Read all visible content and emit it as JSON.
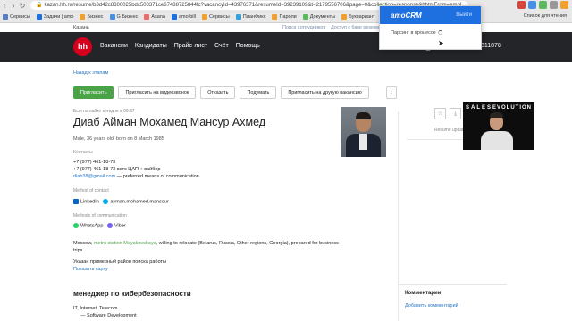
{
  "browser": {
    "url": "kazan.hh.ru/resume/b3d42c8300025bdc500371ce67488725844fc?vacancyId=43976371&resumeId=39239109&t=2179556706&page=0&collection=response&hhtmFrom=empl...",
    "bookmarks": [
      "Сервисы",
      "Задачи | amo",
      "Бизнес",
      "G Бизнес",
      "Asana",
      "amo bill",
      "Сервисы",
      "ПланФикс",
      "Пароли",
      "Документы",
      "Буквариант"
    ],
    "bookmarks_right": "Список для чтения",
    "colors": {
      "ext1": "#d6453b",
      "ext2": "#4a8fe7",
      "ext3": "#5cb85c",
      "ext4": "#999999",
      "ext5": "#f0a030"
    }
  },
  "hh": {
    "city": "Казань",
    "top_links": [
      "Поиск сотрудников",
      "Доступ к базе резюме"
    ],
    "logo": "hh",
    "menu": [
      "Вакансии",
      "Кандидаты",
      "Прайс-лист",
      "Счёт",
      "Помощь"
    ],
    "search_label": "Поиск",
    "phone": "811878"
  },
  "resume": {
    "back_link": "Назад к этапам",
    "actions": [
      "Пригласить",
      "Пригласить на видеозвонок",
      "Отказать",
      "Подумать",
      "Пригласить на другую вакансию"
    ],
    "more_label": "⋮",
    "last_seen": "Был на сайте сегодня в 09:37",
    "name": "Диаб Айман Мохамед Мансур Ахмед",
    "meta": "Male, 36 years old, born on 8 March 1985",
    "contacts_label": "Контакты",
    "phone1": "+7 (977) 461-18-73",
    "phone2": "+7 (977) 461-18-73 ватс ЦАП + вайбер",
    "email": "diab38@gmail.com",
    "email_note": " — preferred means of communication",
    "method_label": "Method of contact",
    "linkedin": "LinkedIn",
    "skype": "ayman.mohamed.mansour",
    "comm_label": "Methods of communication",
    "whatsapp": "WhatsApp",
    "viber": "Viber",
    "location_prefix": "Moscow, ",
    "metro": "metro station Mayakovskaya",
    "location_suffix": ", willing to relocate (Belarus, Russia, Other regions, Georgia), prepared for business",
    "trips": "trips",
    "search_area": "Указан примерный район поиска работы",
    "show_map": "Показать карту",
    "position": "менеджер по кибербезопасности",
    "industry": "IT, Internet, Telecom",
    "specialization": "— Software Development"
  },
  "sidebar": {
    "star": "☆",
    "download": "⤓",
    "resume_update": "Resume update",
    "comments_title": "Комментарии",
    "add_comment": "Добавить комментарий"
  },
  "video": {
    "brand_left": "SALES",
    "brand_right": "EVOLUTION"
  },
  "popup": {
    "logo": "amoCRM",
    "logout": "Выйти",
    "status": "Парсинг в процессе"
  }
}
